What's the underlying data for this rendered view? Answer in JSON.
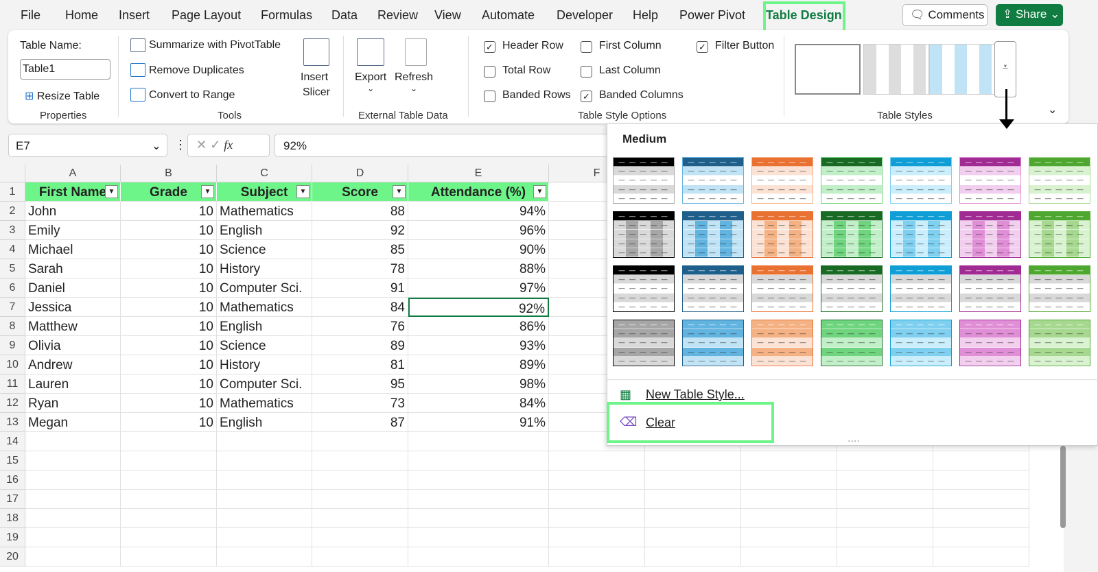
{
  "tabs": [
    "File",
    "Home",
    "Insert",
    "Page Layout",
    "Formulas",
    "Data",
    "Review",
    "View",
    "Automate",
    "Developer",
    "Help",
    "Power Pivot",
    "Table Design"
  ],
  "active_tab": "Table Design",
  "comments_label": "Comments",
  "share_label": "Share",
  "properties": {
    "table_name_label": "Table Name:",
    "table_name": "Table1",
    "resize": "Resize Table",
    "group": "Properties"
  },
  "tools": {
    "pivot": "Summarize with PivotTable",
    "dupes": "Remove Duplicates",
    "convert": "Convert to Range",
    "slicer1": "Insert",
    "slicer2": "Slicer",
    "group": "Tools"
  },
  "external": {
    "export": "Export",
    "refresh": "Refresh",
    "group": "External Table Data"
  },
  "style_options": {
    "group": "Table Style Options",
    "items": [
      {
        "label": "Header Row",
        "checked": true
      },
      {
        "label": "Total Row",
        "checked": false
      },
      {
        "label": "Banded Rows",
        "checked": false
      },
      {
        "label": "First Column",
        "checked": false
      },
      {
        "label": "Last Column",
        "checked": false
      },
      {
        "label": "Banded Columns",
        "checked": true
      },
      {
        "label": "Filter Button",
        "checked": true
      }
    ]
  },
  "table_styles_group": "Table Styles",
  "name_box": "E7",
  "formula": "92%",
  "fx": "fx",
  "columns": [
    "A",
    "B",
    "C",
    "D",
    "E",
    "F"
  ],
  "headers": [
    "First Name",
    "Grade",
    "Subject",
    "Score",
    "Attendance (%)"
  ],
  "rows": [
    [
      "John",
      "10",
      "Mathematics",
      "88",
      "94%"
    ],
    [
      "Emily",
      "10",
      "English",
      "92",
      "96%"
    ],
    [
      "Michael",
      "10",
      "Science",
      "85",
      "90%"
    ],
    [
      "Sarah",
      "10",
      "History",
      "78",
      "88%"
    ],
    [
      "Daniel",
      "10",
      "Computer Sci.",
      "91",
      "97%"
    ],
    [
      "Jessica",
      "10",
      "Mathematics",
      "84",
      "92%"
    ],
    [
      "Matthew",
      "10",
      "English",
      "76",
      "86%"
    ],
    [
      "Olivia",
      "10",
      "Science",
      "89",
      "93%"
    ],
    [
      "Andrew",
      "10",
      "History",
      "81",
      "89%"
    ],
    [
      "Lauren",
      "10",
      "Computer Sci.",
      "95",
      "98%"
    ],
    [
      "Ryan",
      "10",
      "Mathematics",
      "73",
      "84%"
    ],
    [
      "Megan",
      "10",
      "English",
      "87",
      "91%"
    ]
  ],
  "row_numbers": [
    "1",
    "2",
    "3",
    "4",
    "5",
    "6",
    "7",
    "8",
    "9",
    "10",
    "11",
    "12",
    "13",
    "14",
    "15",
    "16",
    "17",
    "18",
    "19",
    "20"
  ],
  "gallery": {
    "section": "Medium",
    "colors": [
      {
        "dark": "#000000",
        "light": "#d9d9d9",
        "mid": "#a6a6a6"
      },
      {
        "dark": "#1f5f8b",
        "light": "#c0e4f5",
        "mid": "#61b3e0"
      },
      {
        "dark": "#e97132",
        "light": "#fbe2d5",
        "mid": "#f4b183"
      },
      {
        "dark": "#196b24",
        "light": "#c1f0c8",
        "mid": "#6fd47e"
      },
      {
        "dark": "#0f9ed5",
        "light": "#caeefb",
        "mid": "#7fd0f0"
      },
      {
        "dark": "#a02b93",
        "light": "#f2cfee",
        "mid": "#e08fd6"
      },
      {
        "dark": "#4ea72e",
        "light": "#d9f2d0",
        "mid": "#a6d98f"
      }
    ]
  },
  "menu": {
    "new_style": "New Table Style...",
    "clear": "Clear"
  }
}
